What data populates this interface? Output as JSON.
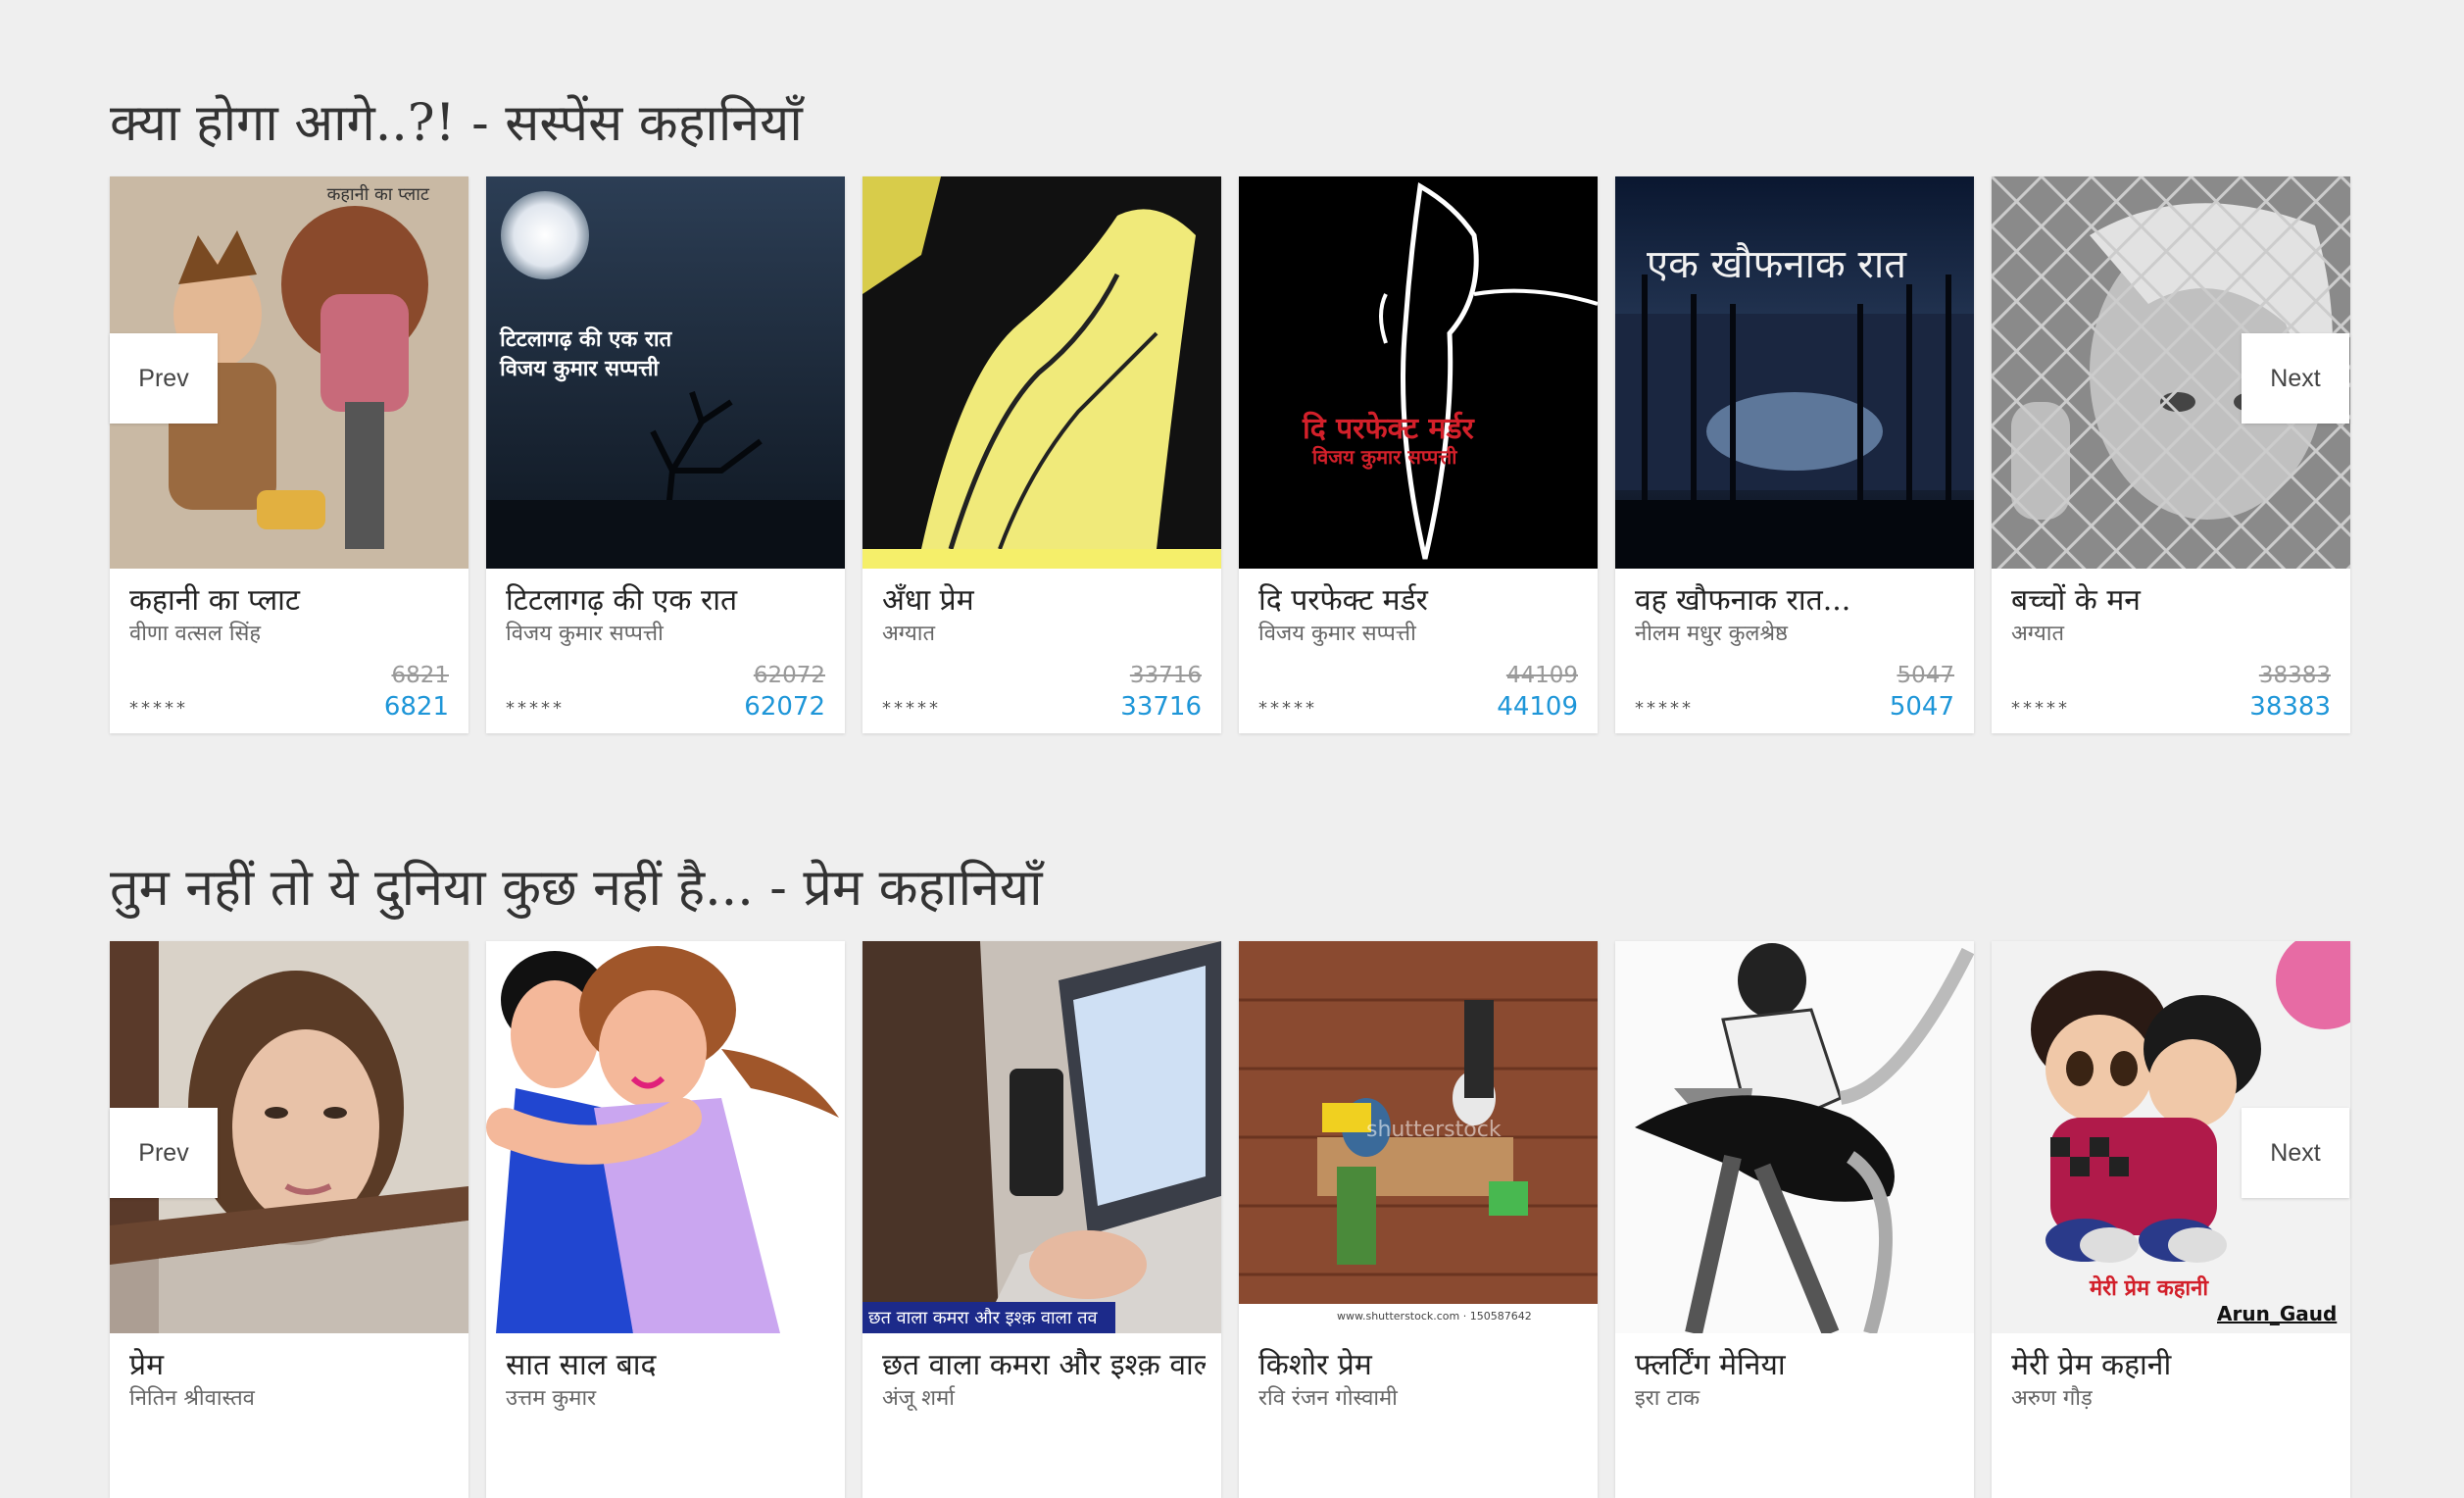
{
  "sections": [
    {
      "title": "क्या होगा आगे..?! - सस्पेंस कहानियाँ",
      "prev_label": "Prev",
      "next_label": "Next",
      "books": [
        {
          "title": "कहानी का प्लाट",
          "author": "वीणा वत्सल सिंह",
          "old_count": "6821",
          "count": "6821",
          "stars": "*****",
          "cover_text": "कहानी का प्लाट"
        },
        {
          "title": "टिटलागढ़ की एक रात",
          "author": "विजय कुमार सप्पत्ती",
          "old_count": "62072",
          "count": "62072",
          "stars": "*****",
          "cover_text": "टिटलागढ़ की एक रात",
          "cover_text2": "विजय कुमार सप्पत्ती"
        },
        {
          "title": "अँधा प्रेम",
          "author": "अग्यात",
          "old_count": "33716",
          "count": "33716",
          "stars": "*****"
        },
        {
          "title": "दि परफेक्ट मर्डर",
          "author": "विजय कुमार सप्पत्ती",
          "old_count": "44109",
          "count": "44109",
          "stars": "*****",
          "cover_text": "दि परफेक्ट मर्डर",
          "cover_text2": "विजय कुमार सप्पत्ती"
        },
        {
          "title": "वह खौफनाक रात...",
          "author": "नीलम मधुर कुलश्रेष्ठ",
          "old_count": "5047",
          "count": "5047",
          "stars": "*****",
          "cover_text": "एक खौफनाक रात"
        },
        {
          "title": "बच्चों के मन",
          "author": "अग्यात",
          "old_count": "38383",
          "count": "38383",
          "stars": "*****"
        }
      ]
    },
    {
      "title": "तुम नहीं तो ये दुनिया कुछ नहीं है... - प्रेम कहानियाँ",
      "prev_label": "Prev",
      "next_label": "Next",
      "books": [
        {
          "title": "प्रेम",
          "author": "नितिन श्रीवास्तव"
        },
        {
          "title": "सात साल बाद",
          "author": "उत्तम कुमार"
        },
        {
          "title": "छत वाला कमरा और इश्क़ वाला तव",
          "author": "अंजू शर्मा",
          "cover_text": "छत वाला कमरा और इश्क़ वाला तव"
        },
        {
          "title": "किशोर प्रेम",
          "author": "रवि रंजन गोस्वामी",
          "cover_text": "www.shutterstock.com · 150587642",
          "cover_text2": "shutterstock"
        },
        {
          "title": "फ्लर्टिंग मेनिया",
          "author": "इरा टाक"
        },
        {
          "title": "मेरी प्रेम कहानी",
          "author": "अरुण गौड़",
          "cover_text": "मेरी प्रेम कहानी",
          "cover_text2": "Arun_Gaud"
        }
      ]
    }
  ]
}
